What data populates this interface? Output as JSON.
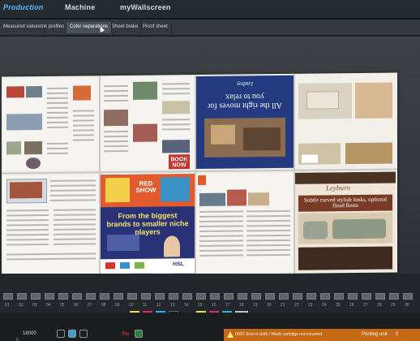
{
  "top_tabs": [
    {
      "label": "Production",
      "active": true
    },
    {
      "label": "Machine",
      "active": false
    },
    {
      "label": "myWallscreen",
      "active": false
    }
  ],
  "sub_tabs": [
    {
      "label": "Measured values"
    },
    {
      "label": "Ink profiles"
    },
    {
      "label": "Color separations",
      "active": true
    },
    {
      "label": "Sheet brake"
    },
    {
      "label": "Proof sheet"
    }
  ],
  "sheet": {
    "ad_headline": "All the right moves for you to relax",
    "ad_brand": "Lazboy",
    "show_text": "RED SHOW",
    "show_text_2": "BOOK NOW",
    "tagline": "From the biggest brands to smaller niche players",
    "leyburn": "Leyburn",
    "leyburn_sub": "Subtle curved stylish looks, optional Head Rests",
    "hsl_logo": "HSL"
  },
  "ink_zone_numbers": [
    "01",
    "02",
    "03",
    "04",
    "05",
    "06",
    "07",
    "08",
    "09",
    "10",
    "11",
    "12",
    "13",
    "14",
    "15",
    "16",
    "17",
    "18",
    "19",
    "20",
    "21",
    "22",
    "23",
    "24",
    "25",
    "26",
    "27",
    "28",
    "29",
    "30"
  ],
  "colors": {
    "accent": "#58b6ff",
    "cyan": "#20b6e6",
    "magenta": "#e0287d",
    "yellow": "#f4e61f",
    "black": "#1a1a1a",
    "warning": "#c46a14"
  },
  "status": {
    "counter": "18000",
    "counter_small": "0",
    "red_label": "Tm",
    "warning_text": "0002: End of cloth / Wash cartridge not mounted",
    "printing_unit_label": "Printing unit",
    "printing_unit_value": "0"
  }
}
